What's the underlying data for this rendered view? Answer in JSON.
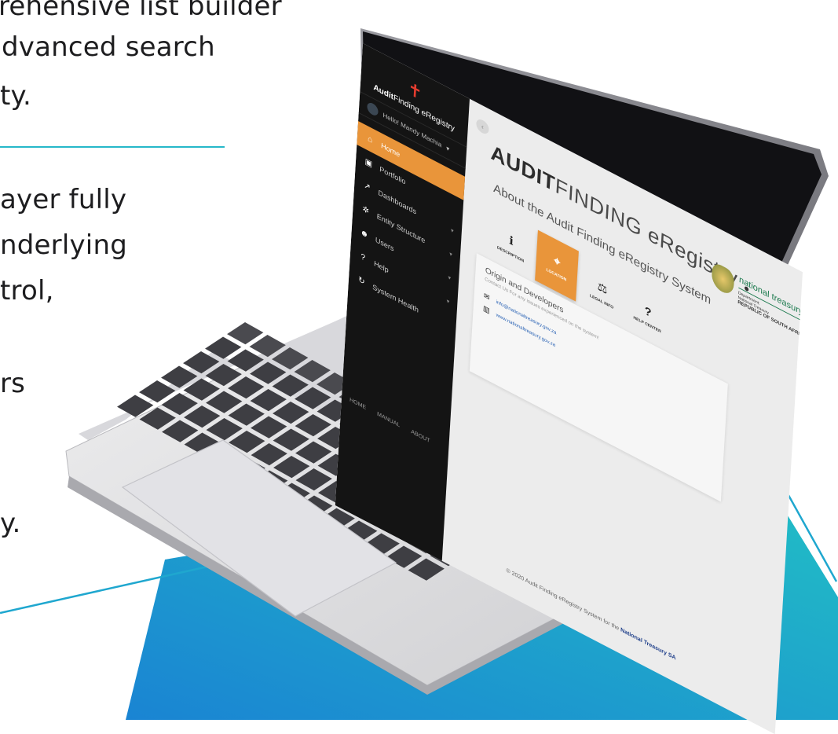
{
  "marketing": {
    "lines": [
      "rehensive list builder",
      "dvanced search",
      "ty.",
      "ayer fully",
      "nderlying",
      "trol,",
      "rs",
      "y."
    ]
  },
  "colors": {
    "accent": "#e9953a",
    "sidebar": "#141414",
    "teal": "#26b8c9",
    "blue": "#1586d1"
  },
  "app": {
    "brand_logo": "✝",
    "brand_bold": "Audit",
    "brand_rest": "Finding eRegistry",
    "user_greeting": "Hello! Mandy Machia",
    "nav": [
      {
        "label": "Home",
        "icon": "home-icon",
        "glyph": "⌂"
      },
      {
        "label": "Portfolio",
        "icon": "briefcase-icon",
        "glyph": "▣"
      },
      {
        "label": "Dashboards",
        "icon": "trend-icon",
        "glyph": "↗"
      },
      {
        "label": "Entity Structure",
        "icon": "gear-icon",
        "glyph": "✲"
      },
      {
        "label": "Users",
        "icon": "users-icon",
        "glyph": "☻"
      },
      {
        "label": "Help",
        "icon": "help-icon",
        "glyph": "?"
      },
      {
        "label": "System Health",
        "icon": "health-icon",
        "glyph": "↻"
      }
    ],
    "bottom_links": [
      "HOME",
      "MANUAL",
      "ABOUT"
    ],
    "title_bold": "AUDIT",
    "title_rest": "FINDING eRegistry",
    "treasury": {
      "name": "national treasury",
      "line1": "Department:",
      "line2": "National Treasury",
      "line3": "REPUBLIC OF SOUTH AFRICA"
    },
    "about_heading": "About the Audit Finding eRegistry System",
    "tabs": [
      {
        "label": "DESCRIPTION",
        "glyph": "ℹ"
      },
      {
        "label": "LOCATION",
        "glyph": "⌖"
      },
      {
        "label": "LEGAL INFO",
        "glyph": "⚖"
      },
      {
        "label": "HELP CENTER",
        "glyph": "?"
      }
    ],
    "card": {
      "heading": "Origin and Developers",
      "subheading": "Contact Us For any issues experienced on the system!",
      "email": "info@nationaltreasury.gov.za",
      "website": "www.nationaltreasury.gov.za"
    },
    "footer_prefix": "© 2020 Audit Finding eRegistry System for the ",
    "footer_bold": "National Treasury SA"
  }
}
